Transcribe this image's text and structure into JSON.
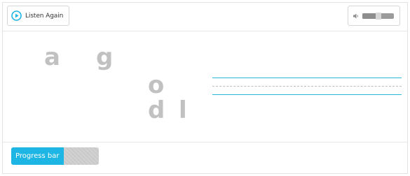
{
  "toolbar": {
    "listen_label": "Listen Again",
    "listen_icon": "play-circle-icon",
    "volume_icon": "speaker-icon",
    "volume_level": 0.5
  },
  "letters": [
    "a",
    "g",
    "o",
    "d",
    "l"
  ],
  "progress": {
    "label": "Progress bar",
    "value": 0.6
  },
  "colors": {
    "accent": "#1db5e3",
    "letter": "#c1c1c1",
    "writing_line": "#2bb7d7"
  }
}
